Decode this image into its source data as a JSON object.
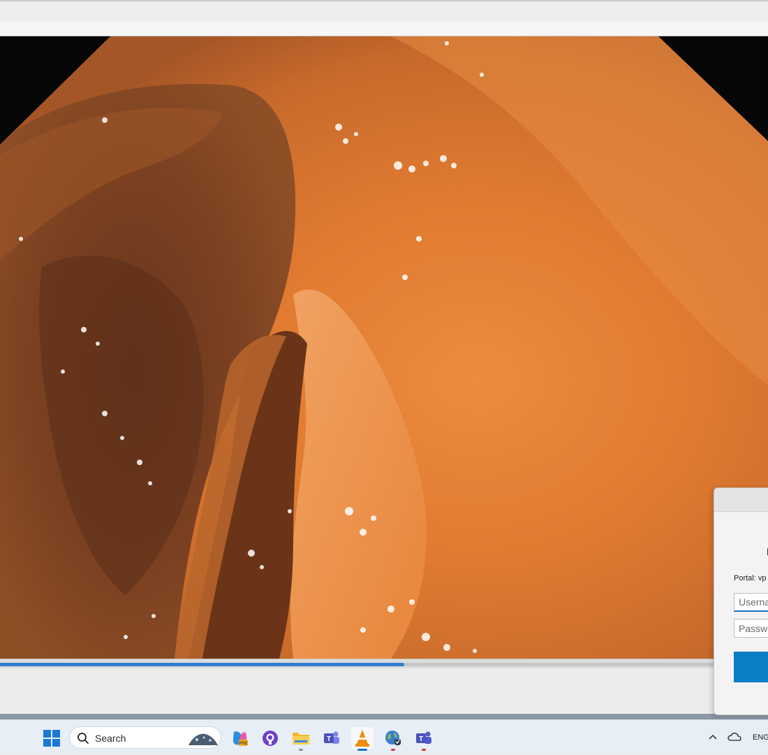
{
  "player": {
    "progress_percent": 52.6
  },
  "taskbar": {
    "search_placeholder": "Search",
    "apps": [
      "start-icon",
      "copilot-icon",
      "github-icon",
      "file-explorer-icon",
      "teams-icon",
      "vlc-icon",
      "globe-vpn-icon",
      "teams-work-icon"
    ],
    "language": "ENG"
  },
  "login_dialog": {
    "portal_label": "Portal: vp",
    "username_placeholder": "Userna",
    "password_placeholder": "Passwo",
    "accent_color": "#0a7fc7"
  }
}
